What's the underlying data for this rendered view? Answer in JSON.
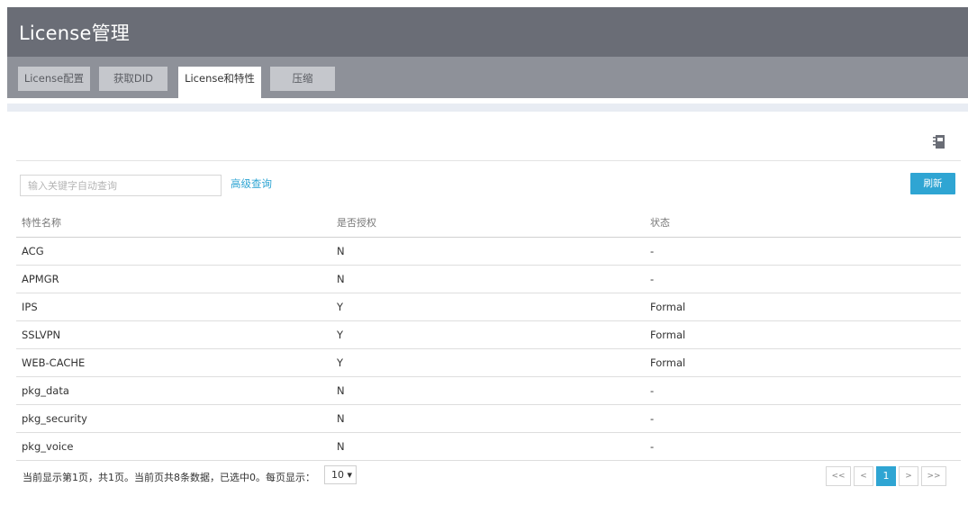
{
  "header": {
    "title": "License管理"
  },
  "tabs": [
    {
      "label": "License配置"
    },
    {
      "label": "获取DID"
    },
    {
      "label": "License和特性"
    },
    {
      "label": "压缩"
    }
  ],
  "toolbar": {
    "search_placeholder": "输入关键字自动查询",
    "advanced_query": "高级查询",
    "refresh_label": "刷新",
    "icon": "book-icon"
  },
  "table": {
    "headers": [
      "特性名称",
      "是否授权",
      "状态"
    ],
    "rows": [
      [
        "ACG",
        "N",
        "-"
      ],
      [
        "APMGR",
        "N",
        "-"
      ],
      [
        "IPS",
        "Y",
        "Formal"
      ],
      [
        "SSLVPN",
        "Y",
        "Formal"
      ],
      [
        "WEB-CACHE",
        "Y",
        "Formal"
      ],
      [
        "pkg_data",
        "N",
        "-"
      ],
      [
        "pkg_security",
        "N",
        "-"
      ],
      [
        "pkg_voice",
        "N",
        "-"
      ]
    ]
  },
  "footer": {
    "summary": "当前显示第1页，共1页。当前页共8条数据，已选中0。每页显示：",
    "page_size": "10 ▾",
    "pager": [
      "<<",
      "<",
      "1",
      ">",
      ">>"
    ]
  },
  "colors": {
    "accent": "#2fa5d3",
    "header_bg": "#6a6d76",
    "tabbar_bg": "#8e9199"
  }
}
